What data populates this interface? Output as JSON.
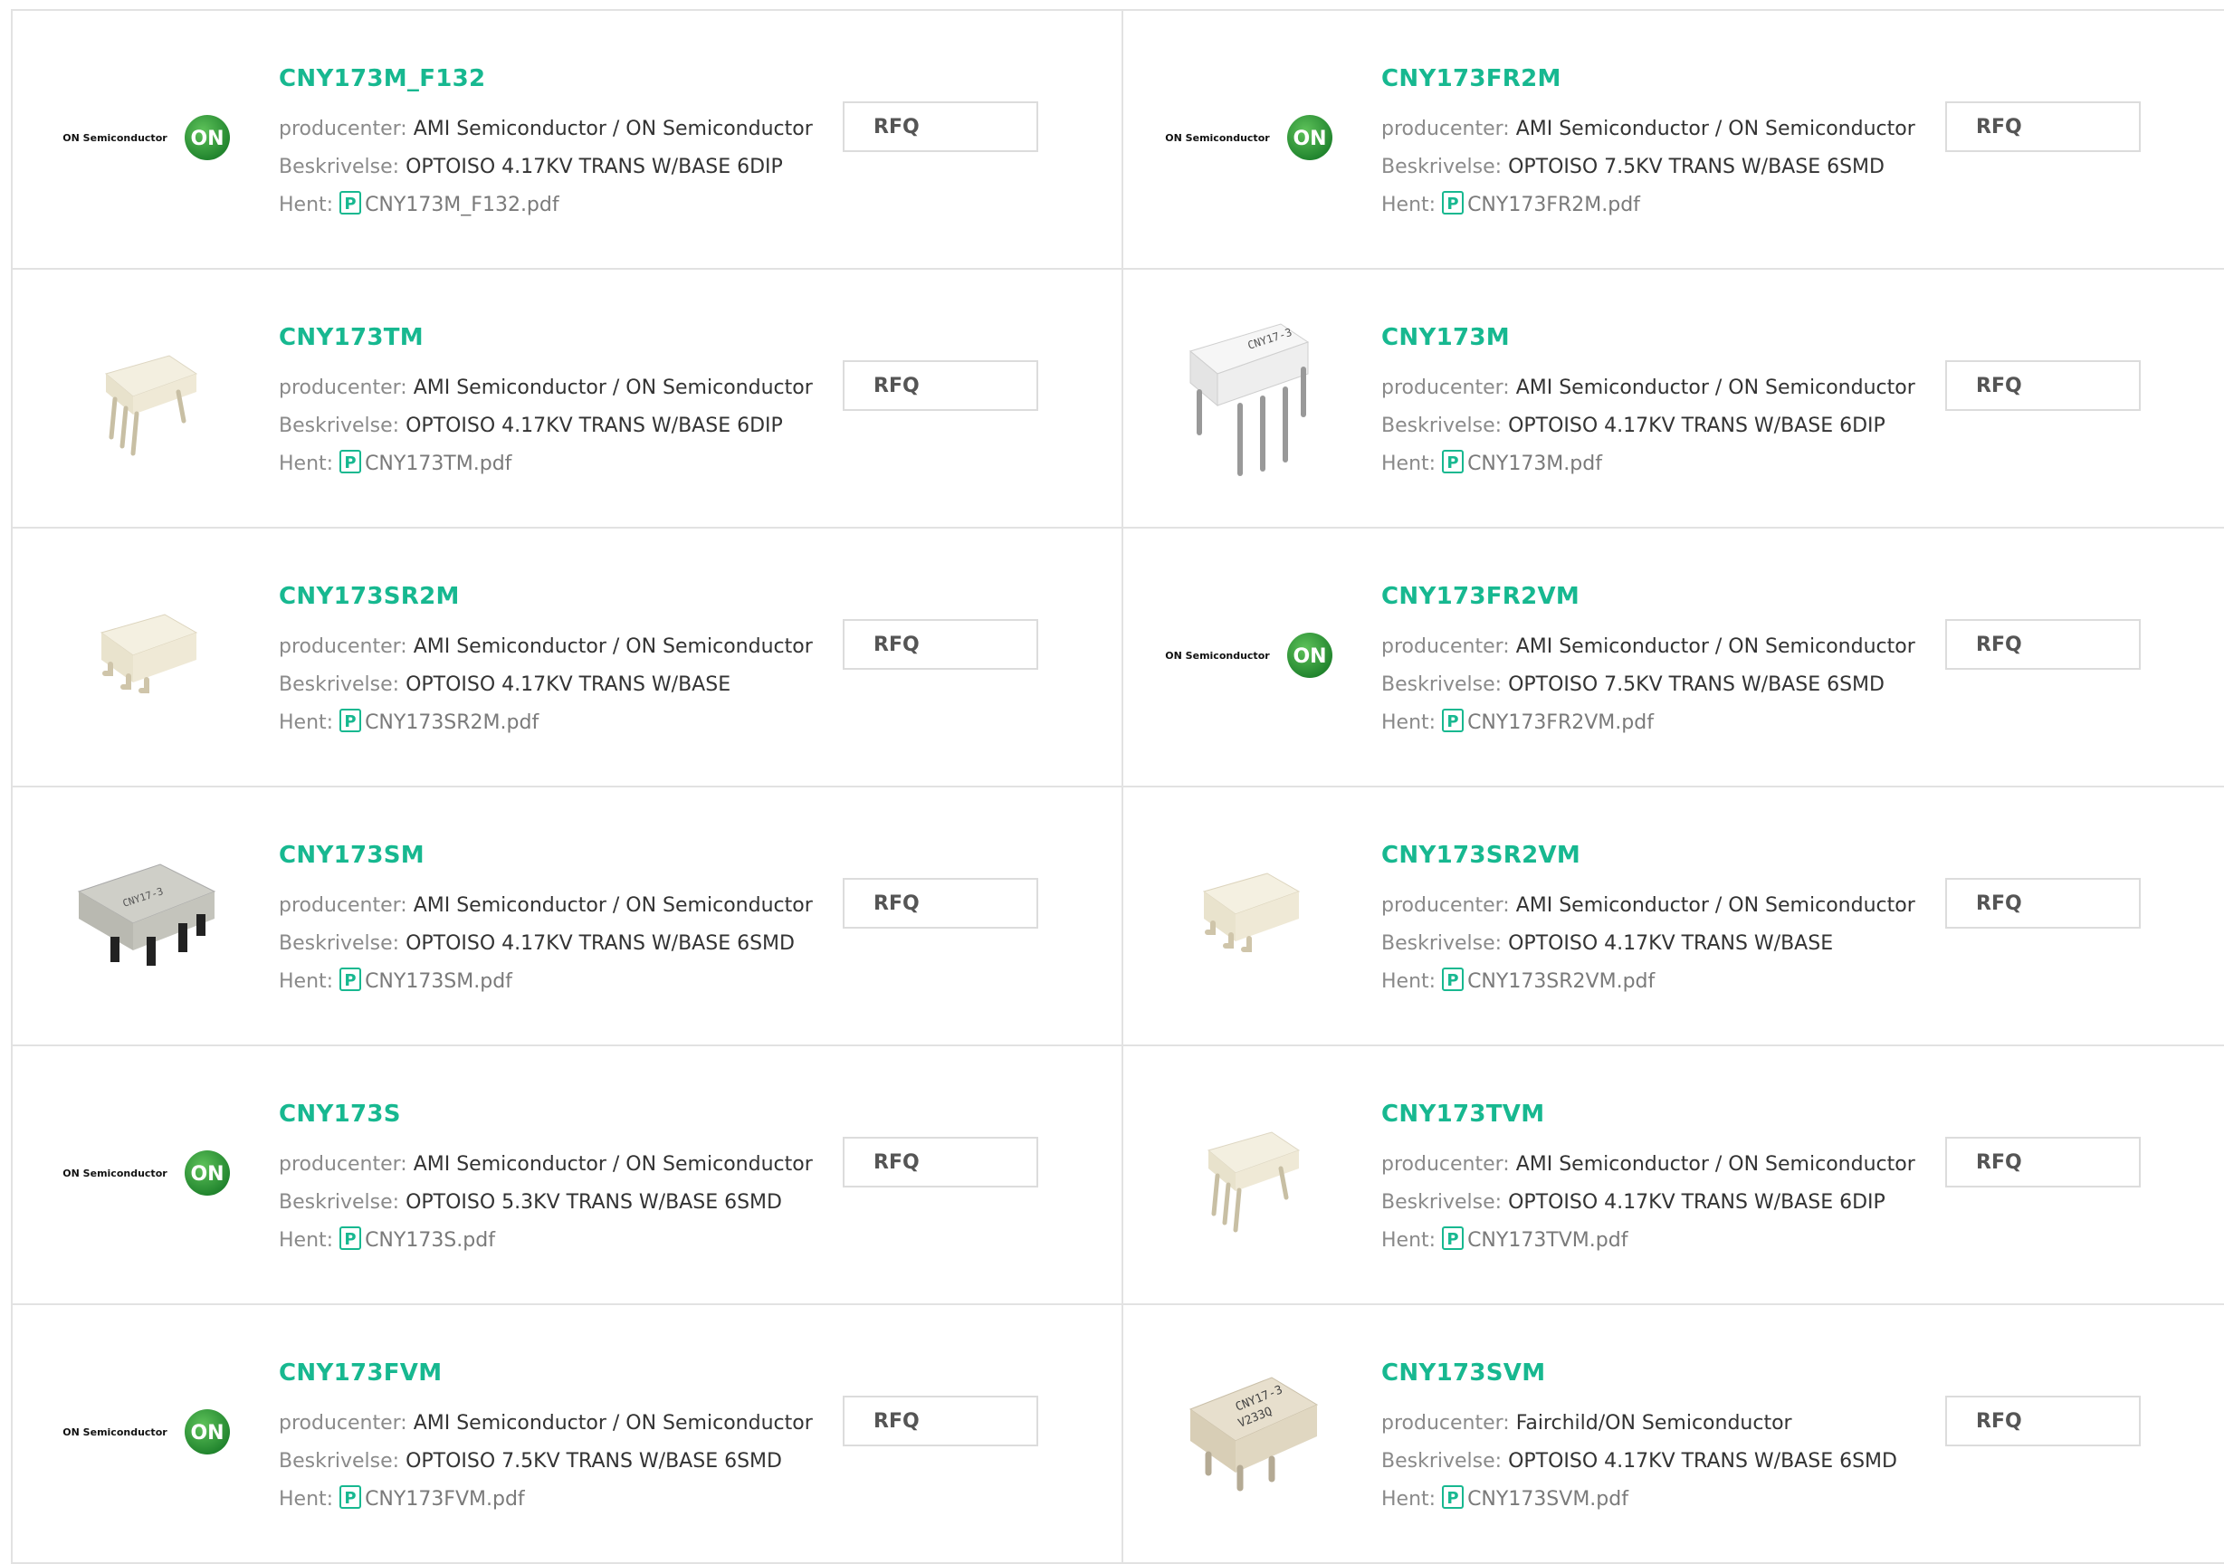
{
  "labels": {
    "manufacturer": "producenter: ",
    "description": "Beskrivelse: ",
    "download": "Hent: ",
    "rfq": "RFQ"
  },
  "logo_text": "ON Semiconductor",
  "logo_badge": "ON",
  "colors": {
    "link": "#17b890",
    "border": "#e2e2e2"
  },
  "products": [
    {
      "pn": "CNY173M_F132",
      "manufacturer": "AMI Semiconductor / ON Semiconductor",
      "description": "OPTOISO 4.17KV TRANS W/BASE 6DIP",
      "file": "CNY173M_F132.pdf",
      "image": "on-semiconductor-logo"
    },
    {
      "pn": "CNY173FR2M",
      "manufacturer": "AMI Semiconductor / ON Semiconductor",
      "description": "OPTOISO 7.5KV TRANS W/BASE 6SMD",
      "file": "CNY173FR2M.pdf",
      "image": "on-semiconductor-logo"
    },
    {
      "pn": "CNY173TM",
      "manufacturer": "AMI Semiconductor / ON Semiconductor",
      "description": "OPTOISO 4.17KV TRANS W/BASE 6DIP",
      "file": "CNY173TM.pdf",
      "image": "dip-chip-cream"
    },
    {
      "pn": "CNY173M",
      "manufacturer": "AMI Semiconductor / ON Semiconductor",
      "description": "OPTOISO 4.17KV TRANS W/BASE 6DIP",
      "file": "CNY173M.pdf",
      "image": "dip-chip-white"
    },
    {
      "pn": "CNY173SR2M",
      "manufacturer": "AMI Semiconductor / ON Semiconductor",
      "description": "OPTOISO 4.17KV TRANS W/BASE",
      "file": "CNY173SR2M.pdf",
      "image": "smd-chip-cream"
    },
    {
      "pn": "CNY173FR2VM",
      "manufacturer": "AMI Semiconductor / ON Semiconductor",
      "description": "OPTOISO 7.5KV TRANS W/BASE 6SMD",
      "file": "CNY173FR2VM.pdf",
      "image": "on-semiconductor-logo"
    },
    {
      "pn": "CNY173SM",
      "manufacturer": "AMI Semiconductor / ON Semiconductor",
      "description": "OPTOISO 4.17KV TRANS W/BASE 6SMD",
      "file": "CNY173SM.pdf",
      "image": "smd-chip-gray"
    },
    {
      "pn": "CNY173SR2VM",
      "manufacturer": "AMI Semiconductor / ON Semiconductor",
      "description": "OPTOISO 4.17KV TRANS W/BASE",
      "file": "CNY173SR2VM.pdf",
      "image": "smd-chip-cream"
    },
    {
      "pn": "CNY173S",
      "manufacturer": "AMI Semiconductor / ON Semiconductor",
      "description": "OPTOISO 5.3KV TRANS W/BASE 6SMD",
      "file": "CNY173S.pdf",
      "image": "on-semiconductor-logo"
    },
    {
      "pn": "CNY173TVM",
      "manufacturer": "AMI Semiconductor / ON Semiconductor",
      "description": "OPTOISO 4.17KV TRANS W/BASE 6DIP",
      "file": "CNY173TVM.pdf",
      "image": "dip-chip-cream"
    },
    {
      "pn": "CNY173FVM",
      "manufacturer": "AMI Semiconductor / ON Semiconductor",
      "description": "OPTOISO 7.5KV TRANS W/BASE 6SMD",
      "file": "CNY173FVM.pdf",
      "image": "on-semiconductor-logo"
    },
    {
      "pn": "CNY173SVM",
      "manufacturer": "Fairchild/ON Semiconductor",
      "description": "OPTOISO 4.17KV TRANS W/BASE 6SMD",
      "file": "CNY173SVM.pdf",
      "image": "smd-chip-marked"
    }
  ]
}
